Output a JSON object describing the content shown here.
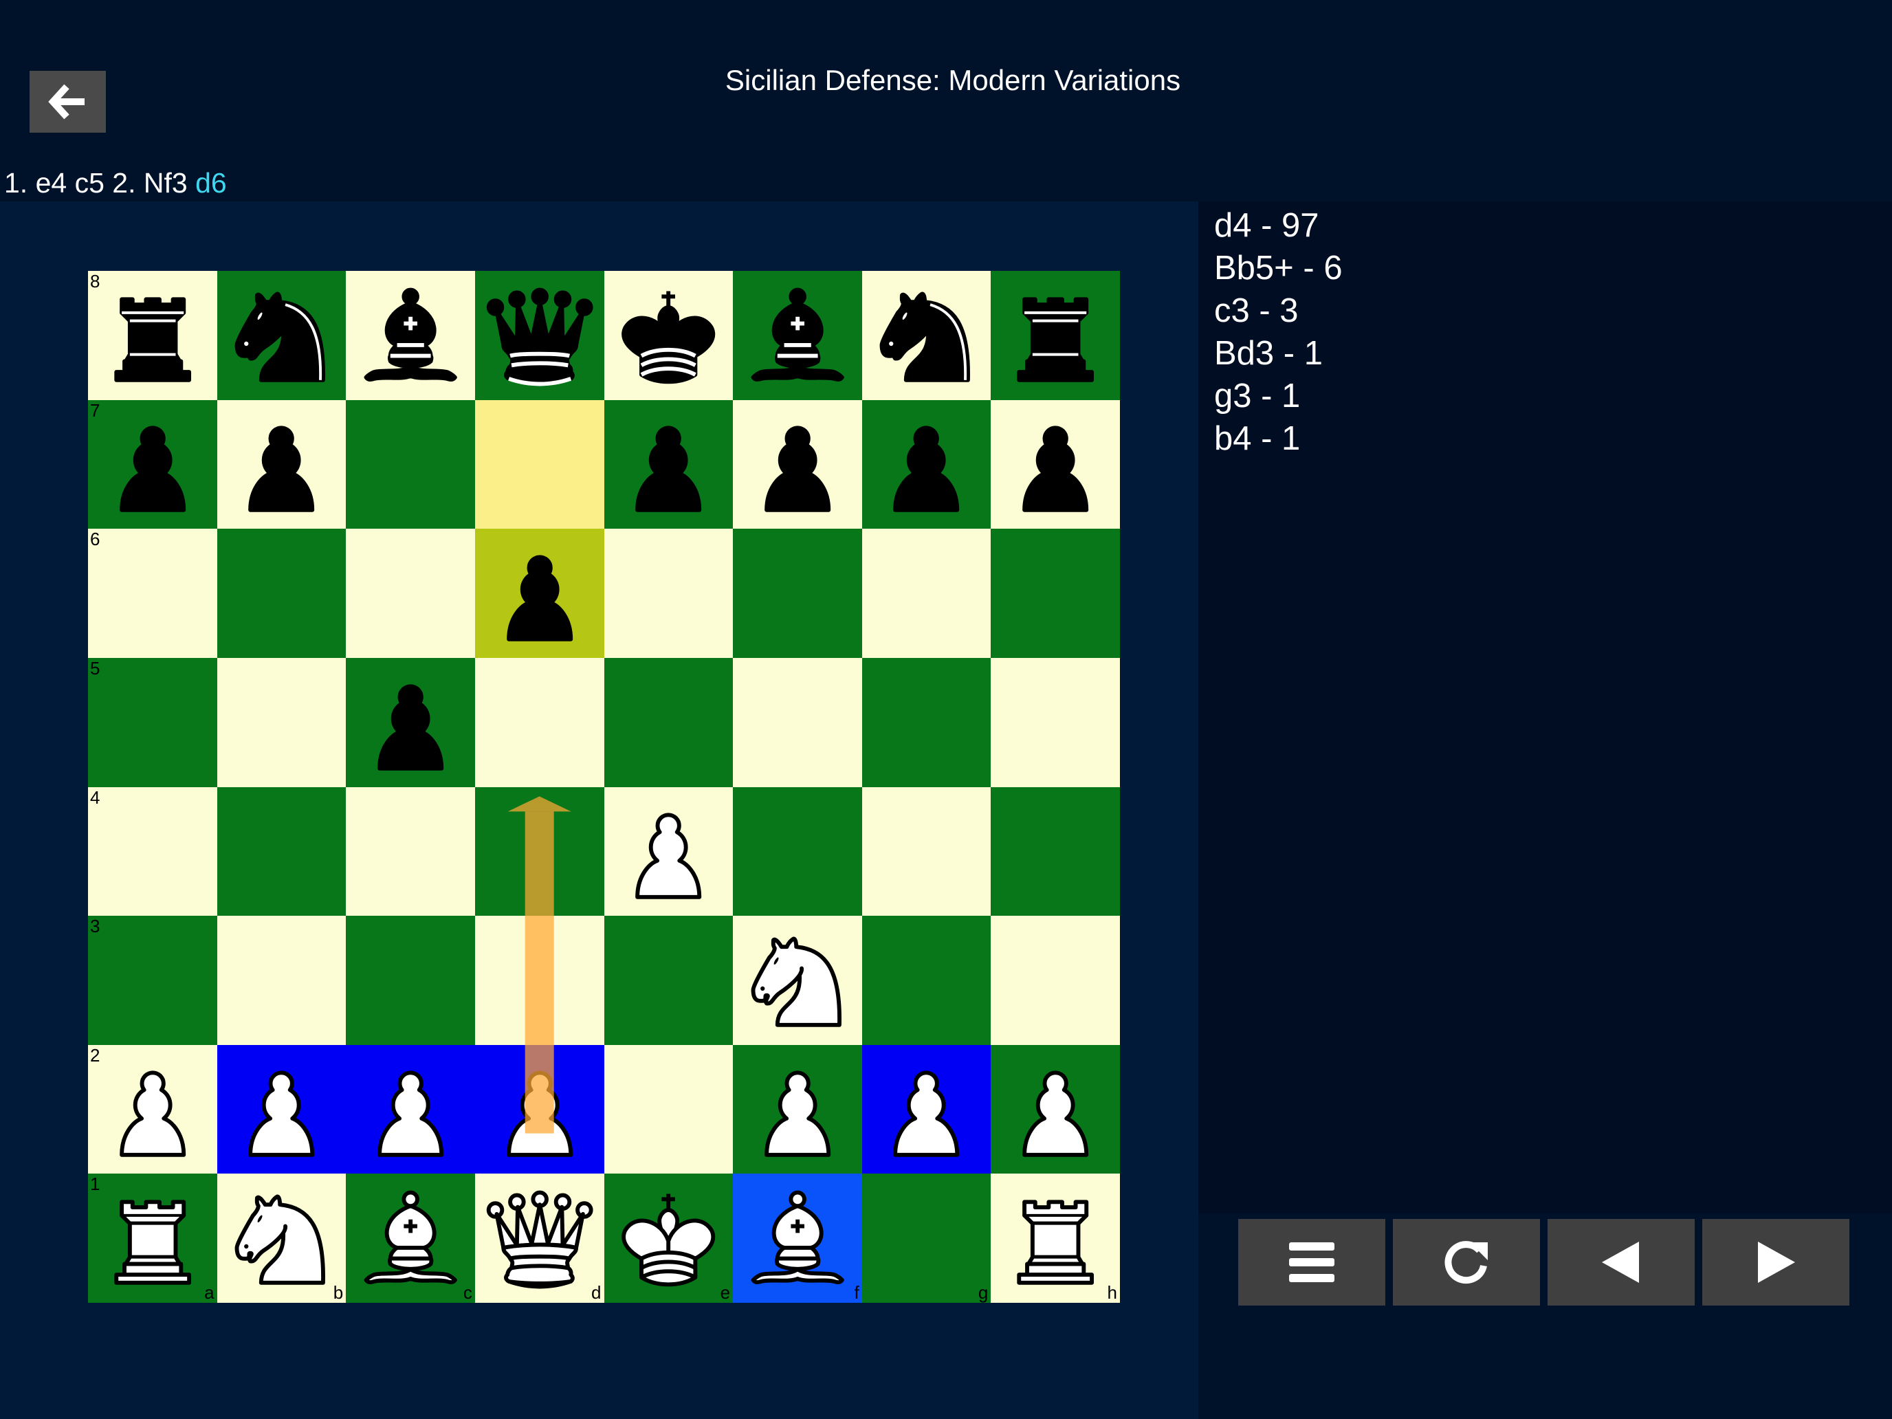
{
  "header": {
    "back_icon": "arrow-left-icon",
    "title": "Sicilian Defense: Modern Variations"
  },
  "move_line": {
    "prefix": "1. e4 c5 2. Nf3 ",
    "current": "d6"
  },
  "candidates": [
    {
      "label": "d4 - 97"
    },
    {
      "label": "Bb5+ - 6"
    },
    {
      "label": "c3 - 3"
    },
    {
      "label": "Bd3 - 1"
    },
    {
      "label": "g3 - 1"
    },
    {
      "label": "b4 - 1"
    }
  ],
  "board": {
    "orientation": "white",
    "rows": [
      [
        "r",
        "n",
        "b",
        "q",
        "k",
        "b",
        "n",
        "r"
      ],
      [
        "p",
        "p",
        "",
        "",
        "p",
        "p",
        "p",
        "p"
      ],
      [
        "",
        "",
        "",
        "p",
        "",
        "",
        "",
        ""
      ],
      [
        "",
        "",
        "p",
        "",
        "",
        "",
        "",
        ""
      ],
      [
        "",
        "",
        "",
        "",
        "P",
        "",
        "",
        ""
      ],
      [
        "",
        "",
        "",
        "",
        "",
        "N",
        "",
        ""
      ],
      [
        "P",
        "P",
        "P",
        "P",
        "",
        "P",
        "P",
        "P"
      ],
      [
        "R",
        "N",
        "B",
        "Q",
        "K",
        "B",
        "",
        "R"
      ]
    ],
    "ranks": [
      "8",
      "7",
      "6",
      "5",
      "4",
      "3",
      "2",
      "1"
    ],
    "files": [
      "a",
      "b",
      "c",
      "d",
      "e",
      "f",
      "g",
      "h"
    ],
    "last_move": {
      "from": "d7",
      "to": "d6"
    },
    "marked_squares": [
      "b2",
      "c2",
      "d2",
      "g2",
      "f1"
    ],
    "arrow": {
      "from": "d2",
      "to": "d4"
    }
  },
  "colors": {
    "light_square": "#fdfdd5",
    "dark_square": "#07771a",
    "last_move_from": "#fbef8a",
    "last_move_to": "#b5c714",
    "marked": "#0000f5",
    "arrow": "#ffa834",
    "current_move": "#3fd8f0"
  },
  "controls": [
    {
      "name": "menu-button",
      "icon": "hamburger-menu-icon"
    },
    {
      "name": "flip-board-button",
      "icon": "rotate-icon"
    },
    {
      "name": "previous-move-button",
      "icon": "triangle-left-icon"
    },
    {
      "name": "next-move-button",
      "icon": "triangle-right-icon"
    }
  ]
}
